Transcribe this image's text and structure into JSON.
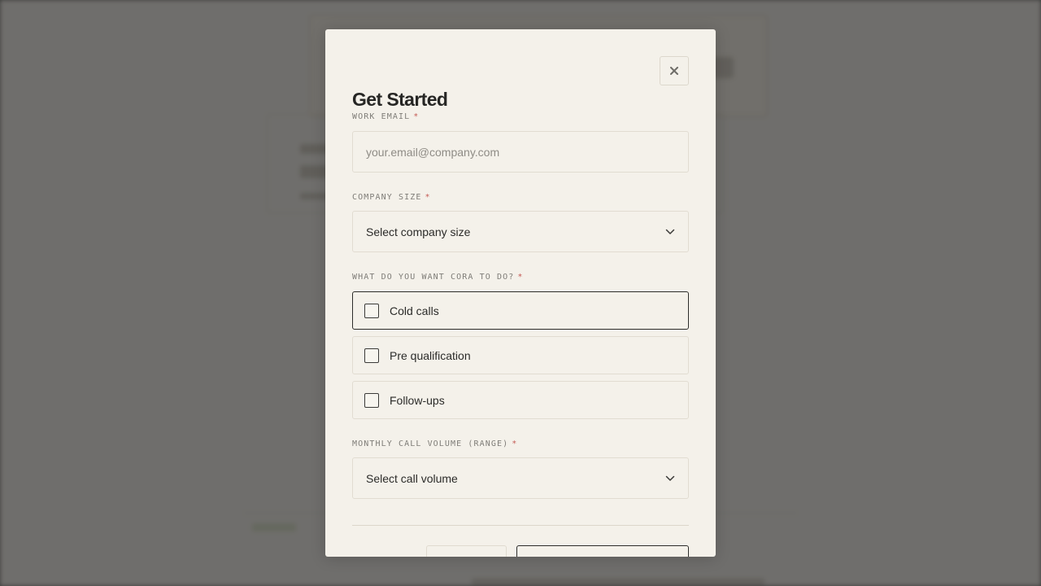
{
  "modal": {
    "title": "Get Started",
    "close_icon": "close-icon"
  },
  "fields": {
    "email": {
      "label": "WORK EMAIL",
      "required_mark": "*",
      "placeholder": "your.email@company.com",
      "value": ""
    },
    "company_size": {
      "label": "COMPANY SIZE",
      "required_mark": "*",
      "selected": "Select company size",
      "icon": "chevron-down-icon"
    },
    "tasks": {
      "label": "WHAT DO YOU WANT CORA TO DO?",
      "required_mark": "*",
      "options": [
        {
          "label": "Cold calls",
          "checked": false
        },
        {
          "label": "Pre qualification",
          "checked": false
        },
        {
          "label": "Follow-ups",
          "checked": false
        }
      ]
    },
    "call_volume": {
      "label": "MONTHLY CALL VOLUME (RANGE)",
      "required_mark": "*",
      "selected": "Select call volume",
      "icon": "chevron-down-icon"
    }
  },
  "colors": {
    "modal_background": "#f4f1ea",
    "required_star": "#c45b55",
    "overlay": "#5a5a58"
  }
}
